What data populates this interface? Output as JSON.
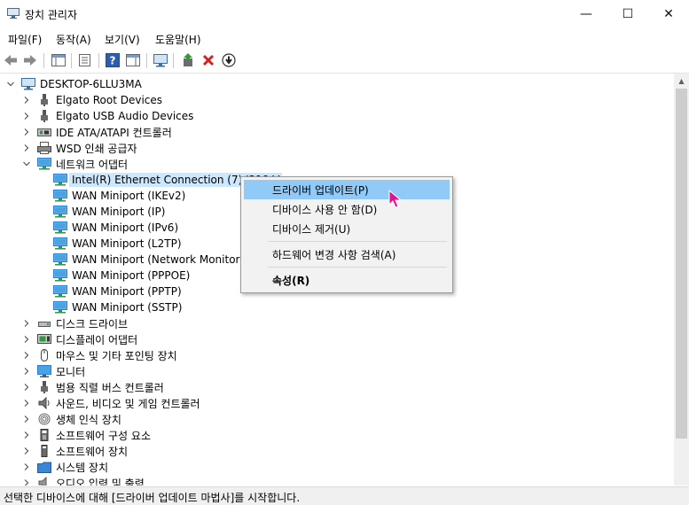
{
  "window": {
    "title": "장치 관리자",
    "minimize": "—",
    "maximize": "☐",
    "close": "✕"
  },
  "menu": [
    "파일(F)",
    "동작(A)",
    "보기(V)",
    "도움말(H)"
  ],
  "tree": {
    "root": "DESKTOP-6LLU3MA",
    "items": [
      {
        "label": "Elgato Root Devices",
        "level": 1,
        "expanded": false,
        "icon": "usb-icon"
      },
      {
        "label": "Elgato USB Audio Devices",
        "level": 1,
        "expanded": false,
        "icon": "usb-icon"
      },
      {
        "label": "IDE ATA/ATAPI 컨트롤러",
        "level": 1,
        "expanded": false,
        "icon": "ide-controller-icon"
      },
      {
        "label": "WSD 인쇄 공급자",
        "level": 1,
        "expanded": false,
        "icon": "printer-icon"
      },
      {
        "label": "네트워크 어댑터",
        "level": 1,
        "expanded": true,
        "icon": "network-adapter-icon"
      },
      {
        "label": "Intel(R) Ethernet Connection (7) I219-V",
        "level": 2,
        "icon": "network-adapter-icon",
        "selected": true
      },
      {
        "label": "WAN Miniport (IKEv2)",
        "level": 2,
        "icon": "network-adapter-icon"
      },
      {
        "label": "WAN Miniport (IP)",
        "level": 2,
        "icon": "network-adapter-icon"
      },
      {
        "label": "WAN Miniport (IPv6)",
        "level": 2,
        "icon": "network-adapter-icon"
      },
      {
        "label": "WAN Miniport (L2TP)",
        "level": 2,
        "icon": "network-adapter-icon"
      },
      {
        "label": "WAN Miniport (Network Monitor)",
        "level": 2,
        "icon": "network-adapter-icon"
      },
      {
        "label": "WAN Miniport (PPPOE)",
        "level": 2,
        "icon": "network-adapter-icon"
      },
      {
        "label": "WAN Miniport (PPTP)",
        "level": 2,
        "icon": "network-adapter-icon"
      },
      {
        "label": "WAN Miniport (SSTP)",
        "level": 2,
        "icon": "network-adapter-icon"
      },
      {
        "label": "디스크 드라이브",
        "level": 1,
        "expanded": false,
        "icon": "disk-drive-icon"
      },
      {
        "label": "디스플레이 어댑터",
        "level": 1,
        "expanded": false,
        "icon": "display-adapter-icon"
      },
      {
        "label": "마우스 및 기타 포인팅 장치",
        "level": 1,
        "expanded": false,
        "icon": "mouse-icon"
      },
      {
        "label": "모니터",
        "level": 1,
        "expanded": false,
        "icon": "monitor-icon"
      },
      {
        "label": "범용 직렬 버스 컨트롤러",
        "level": 1,
        "expanded": false,
        "icon": "usb-icon"
      },
      {
        "label": "사운드, 비디오 및 게임 컨트롤러",
        "level": 1,
        "expanded": false,
        "icon": "speaker-icon"
      },
      {
        "label": "생체 인식 장치",
        "level": 1,
        "expanded": false,
        "icon": "fingerprint-icon"
      },
      {
        "label": "소프트웨어 구성 요소",
        "level": 1,
        "expanded": false,
        "icon": "software-component-icon"
      },
      {
        "label": "소프트웨어 장치",
        "level": 1,
        "expanded": false,
        "icon": "software-device-icon"
      },
      {
        "label": "시스템 장치",
        "level": 1,
        "expanded": false,
        "icon": "system-folder-icon"
      },
      {
        "label": "오디오 입력 및 출력",
        "level": 1,
        "expanded": false,
        "icon": "audio-io-icon"
      }
    ]
  },
  "context_menu": {
    "items": [
      "드라이버 업데이트(P)",
      "디바이스 사용 안 함(D)",
      "디바이스 제거(U)",
      "하드웨어 변경 사항 검색(A)",
      "속성(R)"
    ]
  },
  "status": "선택한 디바이스에 대해 [드라이버 업데이트 마법사]를 시작합니다.",
  "colors": {
    "highlight": "#91c9f7",
    "selection": "#cce8ff",
    "accent": "#2a7fd4"
  }
}
